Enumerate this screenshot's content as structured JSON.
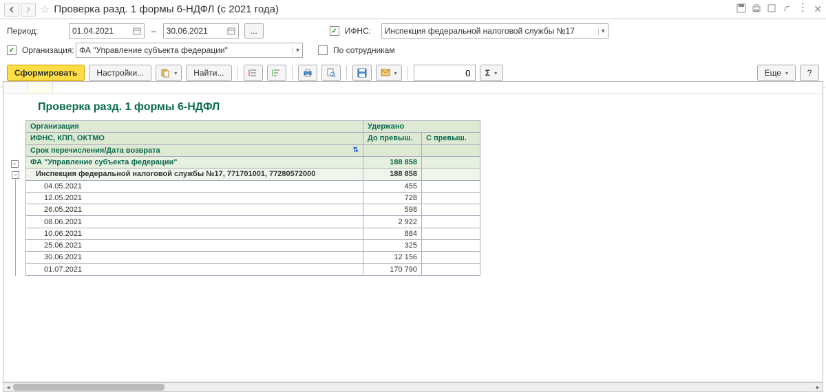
{
  "title": "Проверка разд. 1 формы 6-НДФЛ (с 2021 года)",
  "filters": {
    "period_label": "Период:",
    "date_from": "01.04.2021",
    "date_to": "30.06.2021",
    "ellipsis": "...",
    "ifns_label": "ИФНС:",
    "ifns_value": "Инспекция федеральной налоговой службы №17",
    "org_label": "Организация:",
    "org_value": "ФА \"Управление субъекта федерации\"",
    "by_employees_label": "По сотрудникам"
  },
  "toolbar": {
    "generate": "Сформировать",
    "settings": "Настройки...",
    "find": "Найти...",
    "num_value": "0",
    "more": "Еще",
    "help": "?"
  },
  "report": {
    "title": "Проверка разд. 1 формы 6-НДФЛ",
    "headers": {
      "org": "Организация",
      "withheld": "Удержано",
      "ifns_kpp_oktmo": "ИФНС, КПП, ОКТМО",
      "before_excess": "До превыш.",
      "with_excess": "С превыш.",
      "transfer_date": "Срок перечисления/Дата возврата"
    },
    "group": {
      "name": "ФА \"Управление субъекта федерации\"",
      "total": "188 858"
    },
    "subgroup": {
      "name": "Инспекция федеральной налоговой службы №17, 771701001, 77280572000",
      "total": "188 858"
    },
    "rows": [
      {
        "date": "04.05.2021",
        "v1": "455"
      },
      {
        "date": "12.05.2021",
        "v1": "728"
      },
      {
        "date": "26.05.2021",
        "v1": "598"
      },
      {
        "date": "08.06.2021",
        "v1": "2 922"
      },
      {
        "date": "10.06.2021",
        "v1": "884"
      },
      {
        "date": "25.06.2021",
        "v1": "325"
      },
      {
        "date": "30.06.2021",
        "v1": "12 156"
      },
      {
        "date": "01.07.2021",
        "v1": "170 790"
      }
    ]
  }
}
